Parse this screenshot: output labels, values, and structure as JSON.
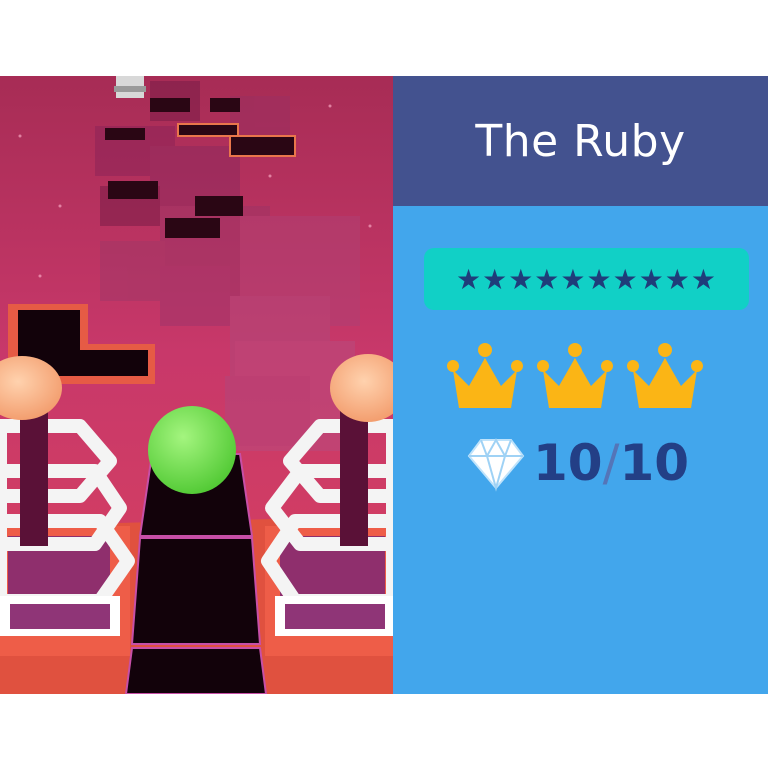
{
  "level_panel": {
    "title": "The Ruby",
    "stars": "★★★★★★★★★★",
    "crowns_earned": 3,
    "gems": {
      "collected": "10",
      "separator": "/",
      "total": "10"
    }
  },
  "colors": {
    "header_bg": "#43528f",
    "panel_bg": "#42a6ec",
    "stars_bar_bg": "#11d0c6",
    "crown": "#fbb515",
    "gem_text": "#233f86",
    "ball": "#7ce85a",
    "scene_sky": "#b8335f"
  },
  "scene": {
    "ball_color": "green"
  }
}
